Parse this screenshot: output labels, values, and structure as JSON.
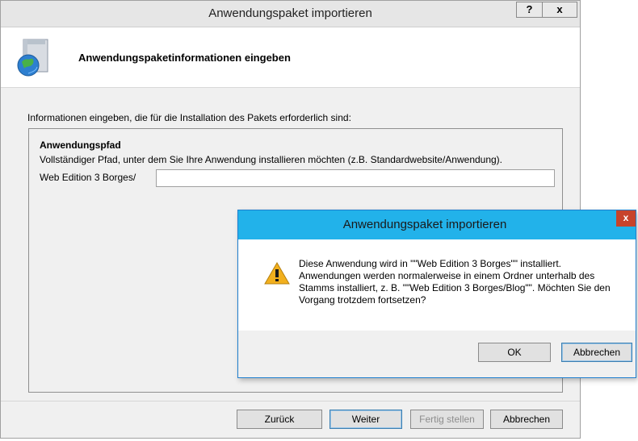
{
  "window": {
    "title": "Anwendungspaket importieren",
    "help_label": "?",
    "close_label": "x"
  },
  "header": {
    "title": "Anwendungspaketinformationen eingeben"
  },
  "content": {
    "intro": "Informationen eingeben, die für die Installation des Pakets erforderlich sind:",
    "group_heading": "Anwendungspfad",
    "group_description": "Vollständiger Pfad, unter dem Sie Ihre Anwendung installieren möchten (z.B. Standardwebsite/Anwendung).",
    "path_label": "Web Edition 3 Borges/",
    "path_value": ""
  },
  "footer": {
    "back_label": "Zurück",
    "next_label": "Weiter",
    "finish_label": "Fertig stellen",
    "cancel_label": "Abbrechen"
  },
  "dialog": {
    "title": "Anwendungspaket importieren",
    "close_label": "x",
    "message": "Diese Anwendung wird in \"\"Web Edition 3 Borges\"\" installiert. Anwendungen werden normalerweise in einem Ordner unterhalb des Stamms installiert, z. B. \"\"Web Edition 3 Borges/Blog\"\". Möchten Sie den Vorgang trotzdem fortsetzen?",
    "ok_label": "OK",
    "cancel_label": "Abbrechen"
  },
  "colors": {
    "dialog_titlebar": "#22b2ea",
    "dialog_close": "#c7432b",
    "warning_icon": "#f2b01e"
  },
  "icons": [
    "package-icon",
    "warning-icon"
  ]
}
